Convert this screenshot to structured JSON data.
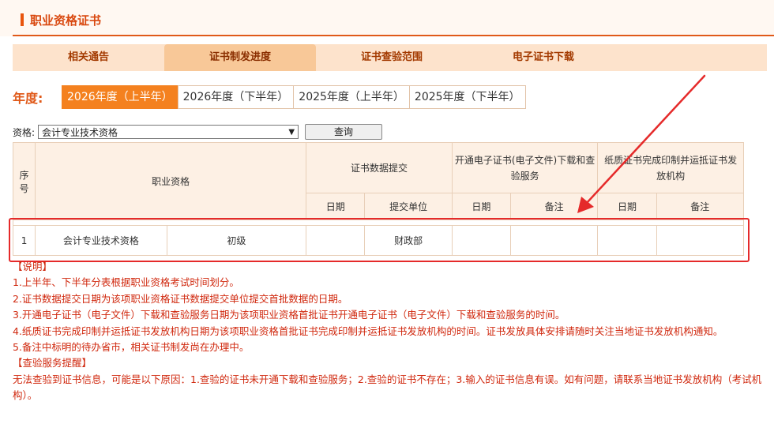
{
  "header": {
    "title": "职业资格证书"
  },
  "tabs": [
    {
      "label": "相关通告",
      "active": false
    },
    {
      "label": "证书制发进度",
      "active": true
    },
    {
      "label": "证书查验范围",
      "active": false
    },
    {
      "label": "电子证书下载",
      "active": false
    }
  ],
  "year": {
    "label": "年度:",
    "options": [
      "2026年度（上半年）",
      "2026年度（下半年）",
      "2025年度（上半年）",
      "2025年度（下半年）"
    ],
    "selected": "2026年度（上半年）"
  },
  "filter": {
    "label": "资格:",
    "selected": "会计专业技术资格",
    "query_label": "查询"
  },
  "table": {
    "headers": {
      "seq": "序号",
      "qualification": "职业资格",
      "data_submit": "证书数据提交",
      "electronic": "开通电子证书(电子文件)下载和查验服务",
      "paper": "纸质证书完成印制并运抵证书发放机构",
      "date": "日期",
      "submit_unit": "提交单位",
      "remark": "备注"
    },
    "rows": [
      {
        "seq": "1",
        "qualification": "会计专业技术资格",
        "level": "初级",
        "submit_date": "",
        "submit_unit": "财政部",
        "e_date": "",
        "e_remark": "",
        "p_date": "",
        "p_remark": ""
      }
    ]
  },
  "notes": {
    "title": "【说明】",
    "items": [
      "1.上半年、下半年分表根据职业资格考试时间划分。",
      "2.证书数据提交日期为该项职业资格证书数据提交单位提交首批数据的日期。",
      "3.开通电子证书（电子文件）下载和查验服务日期为该项职业资格首批证书开通电子证书（电子文件）下载和查验服务的时间。",
      "4.纸质证书完成印制并运抵证书发放机构日期为该项职业资格首批证书完成印制并运抵证书发放机构的时间。证书发放具体安排请随时关注当地证书发放机构通知。",
      "5.备注中标明的待办省市，相关证书制发尚在办理中。"
    ],
    "reminder_title": "【查验服务提醒】",
    "reminder_text": "无法查验到证书信息，可能是以下原因：1.查验的证书未开通下载和查验服务；2.查验的证书不存在；3.输入的证书信息有误。如有问题，请联系当地证书发放机构（考试机构）。"
  },
  "colors": {
    "accent": "#e05a1a",
    "active_year": "#f4811f",
    "note_text": "#d0280e",
    "highlight_box": "#e52a2a"
  }
}
